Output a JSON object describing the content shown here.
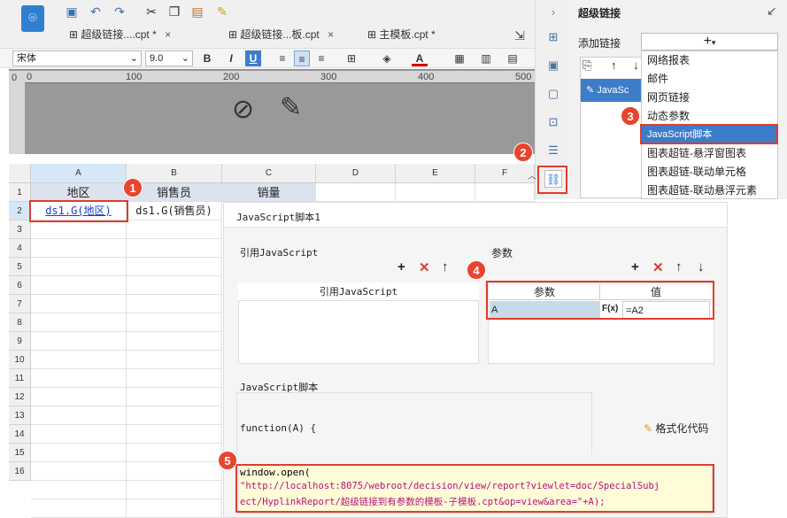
{
  "toolbar": {
    "tabs": [
      {
        "label": "超级链接....cpt *",
        "close": "×"
      },
      {
        "label": "超级链接...板.cpt",
        "close": "×"
      },
      {
        "label": "主模板.cpt *",
        "close": ""
      }
    ],
    "font_name": "宋体",
    "font_size": "9.0",
    "bold_label": "B",
    "italic_label": "I",
    "underline_label": "U",
    "font_color_label": "A"
  },
  "ruler": {
    "labels": [
      "0",
      "100",
      "200",
      "300",
      "400",
      "500"
    ],
    "left_label": "0"
  },
  "sheet": {
    "columns": [
      "A",
      "B",
      "C",
      "D",
      "E",
      "F"
    ],
    "rows": [
      "1",
      "2",
      "3",
      "4",
      "5",
      "6",
      "7",
      "8",
      "9",
      "10",
      "11",
      "12",
      "13",
      "14",
      "15",
      "16"
    ],
    "cells": {
      "a1": "地区",
      "b1": "销售员",
      "c1": "销量",
      "a2": "ds1.G(地区)",
      "b2": "ds1.G(销售员)"
    }
  },
  "right_panel": {
    "title": "超级链接",
    "add_link_label": "添加链接",
    "add_button": "+",
    "list_item": "JavaSc"
  },
  "menu": {
    "items": [
      "网络报表",
      "邮件",
      "网页链接",
      "动态参数",
      "JavaScript脚本",
      "图表超链-悬浮窗图表",
      "图表超链-联动单元格",
      "图表超链-联动悬浮元素"
    ],
    "selected_index": 4
  },
  "dialog": {
    "title": "JavaScript脚本1",
    "ref_js_title": "引用JavaScript",
    "ref_js_header": "引用JavaScript",
    "params_title": "参数",
    "params_col_param": "参数",
    "params_col_value": "值",
    "param_name": "A",
    "param_fx": "F(x)",
    "param_value": "=A2",
    "script_title": "JavaScript脚本",
    "function_sig": "function(A) {",
    "format_code": "格式化代码",
    "code_line1": "window.open(",
    "code_line2": "\"http://localhost:8075/webroot/decision/view/report?viewlet=doc/SpecialSubj",
    "code_line3": "ect/HyplinkReport/超级链接到有参数的模板-子模板.cpt&op=view&area=\"+A);"
  },
  "badges": [
    "1",
    "2",
    "3",
    "4",
    "5"
  ],
  "colors": {
    "accent_red": "#e03c2c",
    "selected_blue": "#3d7cc9",
    "link_blue": "#1a3fc4"
  }
}
